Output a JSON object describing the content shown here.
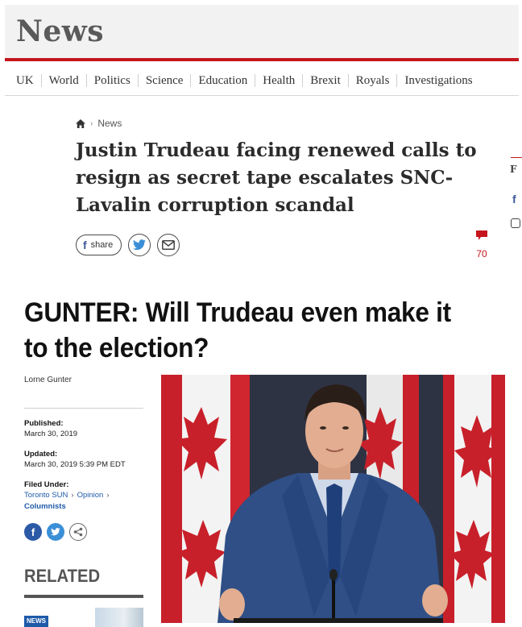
{
  "telegraph": {
    "section_title": "News",
    "nav": [
      "UK",
      "World",
      "Politics",
      "Science",
      "Education",
      "Health",
      "Brexit",
      "Royals",
      "Investigations"
    ],
    "breadcrumb": "News",
    "headline": "Justin Trudeau facing renewed calls to resign as secret tape escalates SNC-Lavalin corruption scandal",
    "share_label": "share",
    "comment_count": "70",
    "side_cut_letter": "F"
  },
  "sun": {
    "headline": "GUNTER: Will Trudeau even make it to the election?",
    "author": "Lorne Gunter",
    "published_label": "Published:",
    "published_date": "March 30, 2019",
    "updated_label": "Updated:",
    "updated_date": "March 30, 2019 5:39 PM EDT",
    "filed_label": "Filed Under:",
    "filed_items": [
      "Toronto SUN",
      "Opinion"
    ],
    "filed_last": "Columnists",
    "related_label": "RELATED",
    "news_tag": "NEWS"
  },
  "colors": {
    "telegraph_red": "#c5161d",
    "sun_link_blue": "#1e5aa8",
    "facebook_blue": "#3b5998"
  },
  "icons": [
    "home-icon",
    "facebook-icon",
    "twitter-icon",
    "email-icon",
    "comment-icon",
    "share-icon"
  ]
}
